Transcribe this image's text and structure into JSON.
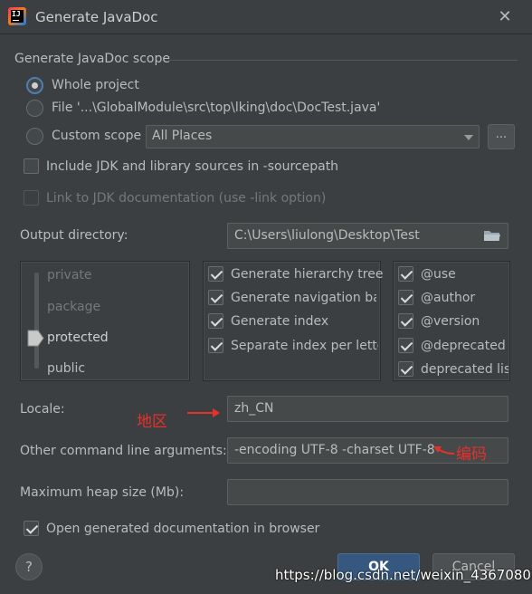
{
  "window": {
    "title": "Generate JavaDoc",
    "close_glyph": "✕"
  },
  "scope": {
    "section_title": "Generate JavaDoc scope",
    "whole_project": "Whole project",
    "file_option": "File '...\\GlobalModule\\src\\top\\lking\\doc\\DocTest.java'",
    "custom_scope": "Custom scope",
    "custom_scope_value": "All Places",
    "browse_label": "...",
    "selected": "whole_project"
  },
  "options": {
    "include_jdk": "Include JDK and library sources in -sourcepath",
    "include_jdk_checked": false,
    "link_jdk": "Link to JDK documentation (use -link option)",
    "link_jdk_checked": false
  },
  "output": {
    "label": "Output directory:",
    "value": "C:\\Users\\liulong\\Desktop\\Test",
    "icon": "folder-icon"
  },
  "visibility": {
    "levels": [
      "private",
      "package",
      "protected",
      "public"
    ],
    "selected": "protected"
  },
  "generate": [
    {
      "label": "Generate hierarchy tree",
      "checked": true
    },
    {
      "label": "Generate navigation bar",
      "checked": true
    },
    {
      "label": "Generate index",
      "checked": true
    },
    {
      "label": "Separate index per letter",
      "checked": true
    }
  ],
  "tags": [
    {
      "label": "@use",
      "checked": true
    },
    {
      "label": "@author",
      "checked": true
    },
    {
      "label": "@version",
      "checked": true
    },
    {
      "label": "@deprecated",
      "checked": true
    },
    {
      "label": "deprecated list",
      "checked": true
    }
  ],
  "locale": {
    "label": "Locale:",
    "value": "zh_CN",
    "annotation": "地区"
  },
  "cmd_args": {
    "label": "Other command line arguments:",
    "value": "-encoding UTF-8 -charset UTF-8",
    "annotation": "编码"
  },
  "heap": {
    "label": "Maximum heap size (Mb):",
    "value": ""
  },
  "open_browser": {
    "label": "Open generated documentation in browser",
    "checked": true
  },
  "buttons": {
    "help": "?",
    "ok": "OK",
    "cancel": "Cancel"
  },
  "watermark": "https://blog.csdn.net/weixin_43670802",
  "colors": {
    "background": "#3c3f41",
    "accent": "#365880",
    "annotation": "#e8302a"
  }
}
